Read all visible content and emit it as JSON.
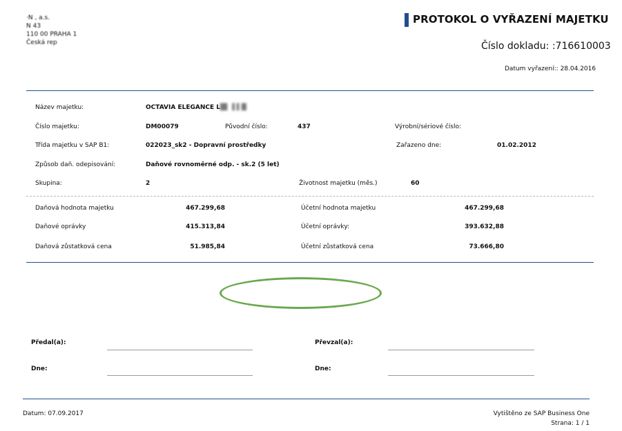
{
  "company": {
    "address_lines": [
      "·N ,  a.s.",
      "N        43",
      "110 00  PRAHA 1",
      "Česká rep"
    ]
  },
  "header": {
    "title": "PROTOKOL O VYŘAZENÍ MAJETKU",
    "doc_number": "Číslo dokladu: :716610003",
    "retirement_date": "Datum vyřazení:: 28.04.2016"
  },
  "asset": {
    "name_label": "Název majetku:",
    "name_value": "OCTAVIA ELEGANCE L",
    "number_label": "Číslo majetku:",
    "number_value": "DM00079",
    "original_label": "Původní číslo:",
    "original_value": "437",
    "serial_label": "Výrobní/sériové číslo:",
    "serial_value": "",
    "class_label": "Třída majetku v SAP B1:",
    "class_value": "022023_sk2 - Dopravní prostředky",
    "assigned_label": "Zařazeno dne:",
    "assigned_value": "01.02.2012",
    "method_label": "Způsob daň. odepisování:",
    "method_value": "Daňové rovnoměrné odp. - sk.2 (5 let)",
    "group_label": "Skupina:",
    "group_value": "2",
    "life_label": "Životnost majetku (měs.)",
    "life_value": "60"
  },
  "values": {
    "tax_value_label": "Daňová hodnota majetku",
    "tax_value": "467.299,68",
    "tax_dep_label": "Daňové oprávky",
    "tax_dep": "415.313,84",
    "tax_residual_label": "Daňová zůstatková cena",
    "tax_residual": "51.985,84",
    "acc_value_label": "Účetní hodnota majetku",
    "acc_value": "467.299,68",
    "acc_dep_label": "Účetní oprávky:",
    "acc_dep": "393.632,88",
    "acc_residual_label": "Účetní zůstatková cena",
    "acc_residual": "73.666,80"
  },
  "signatures": {
    "handed_label": "Předal(a):",
    "received_label": "Převzal(a):",
    "date_label": "Dne:",
    "date_label_2": "Dne:"
  },
  "footer": {
    "date": "Datum: 07.09.2017",
    "printed_from": "Vytištěno ze SAP Business One",
    "page": "Strana: 1 / 1"
  }
}
